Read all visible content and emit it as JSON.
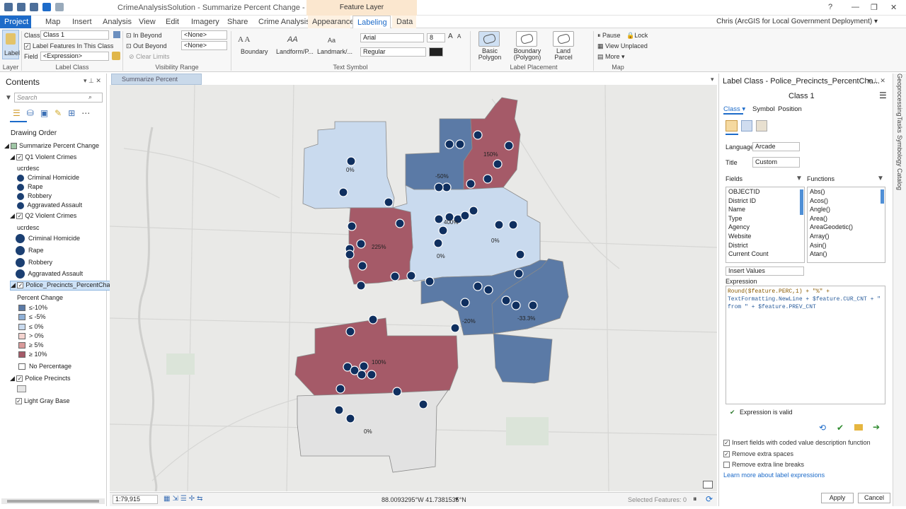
{
  "window": {
    "title": "CrimeAnalysisSolution - Summarize Percent Change - ArcGIS Pro",
    "context_group": "Feature Layer",
    "help": "?",
    "user": "Chris (ArcGIS for Local Government Deployment) ▾"
  },
  "tabs": [
    "Project",
    "Map",
    "Insert",
    "Analysis",
    "View",
    "Edit",
    "Imagery",
    "Share",
    "Crime Analysis",
    "Appearance",
    "Labeling",
    "Data"
  ],
  "ribbon": {
    "layer_group": "Layer",
    "label_btn": "Label",
    "class_label": "Class",
    "class_value": "Class 1",
    "label_features_chk": "Label Features In This Class",
    "field_label": "Field",
    "field_value": "<Expression>",
    "label_class_group": "Label Class",
    "in_beyond": "In Beyond",
    "out_beyond": "Out Beyond",
    "none1": "<None>",
    "none2": "<None>",
    "clear_limits": "Clear Limits",
    "visibility_group": "Visibility Range",
    "style1": "Boundary",
    "style2": "Landform/P...",
    "style3": "Landmark/...",
    "font": "Arial",
    "font_size": "8",
    "font_style": "Regular",
    "text_symbol_group": "Text Symbol",
    "place1": "Basic Polygon",
    "place2": "Boundary (Polygon)",
    "place3": "Land Parcel",
    "label_placement_group": "Label Placement",
    "pause": "Pause",
    "lock": "Lock",
    "view_unplaced": "View Unplaced",
    "more": "More ▾",
    "map_group": "Map"
  },
  "contents": {
    "title": "Contents",
    "search_placeholder": "Search",
    "drawing_order": "Drawing Order",
    "map_name": "Summarize Percent Change",
    "layer1": "Q1 Violent Crimes",
    "layer1_field": "ucrdesc",
    "layer1_items": [
      "Criminal Homicide",
      "Rape",
      "Robbery",
      "Aggravated Assault"
    ],
    "layer2": "Q2 Violent Crimes",
    "layer2_field": "ucrdesc",
    "layer2_items": [
      "Criminal Homicide",
      "Rape",
      "Robbery",
      "Aggravated Assault"
    ],
    "layer3": "Police_Precincts_PercentChange",
    "layer3_field": "Percent Change",
    "layer3_items": [
      "≤-10%",
      "≤ -5%",
      "≤ 0%",
      "> 0%",
      "≥ 5%",
      "≥ 10%"
    ],
    "layer3_nopct": "No Percentage",
    "layer4": "Police Precincts",
    "layer5": "Light Gray Base",
    "colors": {
      "c1": "#5b7aa6",
      "c2": "#8fb0d6",
      "c3": "#c9daee",
      "c4": "#f4d4d0",
      "c5": "#d99a9a",
      "c6": "#a55a68"
    }
  },
  "map": {
    "tab_label": "Summarize Percent Change",
    "labels": [
      "0%",
      "-50%",
      "150%",
      "400%",
      "0%",
      "225%",
      "0%",
      "-20%",
      "-33.3%",
      "100%",
      "0%"
    ],
    "scale": "1:79,915",
    "coords": "88.0093295°W 41.7381535°N",
    "selected": "Selected Features: 0"
  },
  "label_class": {
    "pane_title": "Label Class - Police_Precincts_PercentCha...",
    "class_name": "Class 1",
    "subtab_class": "Class ▾",
    "subtab_symbol": "Symbol",
    "subtab_position": "Position",
    "language_label": "Language",
    "language_value": "Arcade",
    "title_label": "Title",
    "title_value": "Custom",
    "fields_label": "Fields",
    "functions_label": "Functions",
    "fields": [
      "OBJECTID",
      "District ID",
      "Name",
      "Type",
      "Agency",
      "Website",
      "District",
      "Current Count"
    ],
    "functions": [
      "Abs()",
      "Acos()",
      "Angle()",
      "Area()",
      "AreaGeodetic()",
      "Array()",
      "Asin()",
      "Atan()"
    ],
    "insert_values": "Insert Values",
    "expression_label": "Expression",
    "expr_line1": "Round($feature.PERC,1) + \"%\" +",
    "expr_line2": "TextFormatting.NewLine + $feature.CUR_CNT + \"",
    "expr_line3": "from \" + $feature.PREV_CNT",
    "valid": "Expression is valid",
    "opt1": "Insert fields with coded value description function",
    "opt2": "Remove extra spaces",
    "opt3": "Remove extra line breaks",
    "learn_more": "Learn more about label expressions",
    "apply": "Apply",
    "cancel": "Cancel"
  },
  "side_tabs": [
    "Geoprocessing",
    "Tasks",
    "Symbology",
    "Catalog"
  ]
}
